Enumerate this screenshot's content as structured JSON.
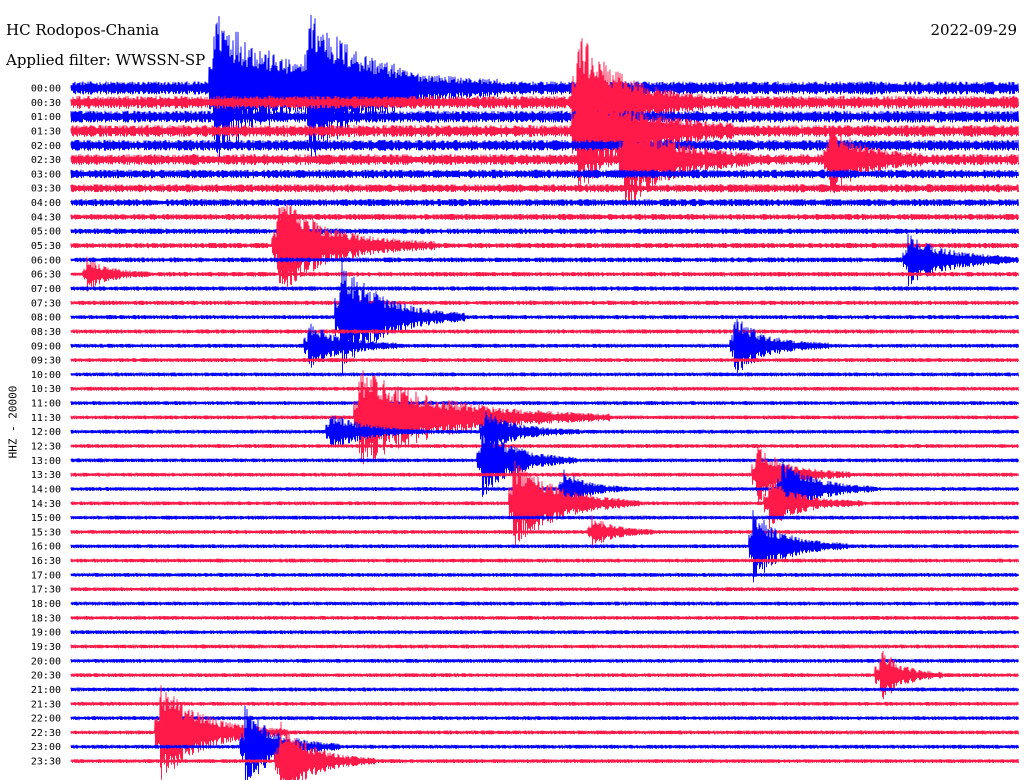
{
  "header": {
    "station": "HC Rodopos-Chania",
    "filter": "Applied filter: WWSSN-SP",
    "date": "2022-09-29"
  },
  "colors": {
    "trace_a": "#0000ff",
    "trace_b": "#ff1a4a",
    "background": "#ffffff"
  },
  "chart_data": {
    "type": "line",
    "ylabel": "HHZ - 20000",
    "row_labels": [
      "00:00",
      "00:30",
      "01:00",
      "01:30",
      "02:00",
      "02:30",
      "03:00",
      "03:30",
      "04:00",
      "04:30",
      "05:00",
      "05:30",
      "06:00",
      "06:30",
      "07:00",
      "07:30",
      "08:00",
      "08:30",
      "09:00",
      "09:30",
      "10:00",
      "10:30",
      "11:00",
      "11:30",
      "12:00",
      "12:30",
      "13:00",
      "13:30",
      "14:00",
      "14:30",
      "15:00",
      "15:30",
      "16:00",
      "16:30",
      "17:00",
      "17:30",
      "18:00",
      "18:30",
      "19:00",
      "19:30",
      "20:00",
      "20:30",
      "21:00",
      "21:30",
      "22:00",
      "22:30",
      "23:00",
      "23:30"
    ],
    "row_minutes": 30,
    "color_alternation": [
      "blue",
      "red"
    ],
    "noise_level_by_row": [
      1.0,
      1.0,
      0.9,
      0.9,
      0.8,
      0.8,
      0.6,
      0.55,
      0.45,
      0.35,
      0.3,
      0.28,
      0.25,
      0.22,
      0.2,
      0.2,
      0.18,
      0.18,
      0.16,
      0.16,
      0.15,
      0.15,
      0.15,
      0.15,
      0.15,
      0.15,
      0.15,
      0.15,
      0.15,
      0.15,
      0.15,
      0.15,
      0.15,
      0.15,
      0.15,
      0.15,
      0.15,
      0.15,
      0.15,
      0.15,
      0.15,
      0.15,
      0.15,
      0.15,
      0.15,
      0.15,
      0.15,
      0.15
    ],
    "events": [
      {
        "row": 0,
        "minute": 4.5,
        "amplitude": 4.0,
        "duration_min": 6
      },
      {
        "row": 0,
        "minute": 7.5,
        "amplitude": 3.0,
        "duration_min": 6
      },
      {
        "row": 1,
        "minute": 16,
        "amplitude": 3.5,
        "duration_min": 4
      },
      {
        "row": 3,
        "minute": 16,
        "amplitude": 3.0,
        "duration_min": 5
      },
      {
        "row": 5,
        "minute": 17.5,
        "amplitude": 2.5,
        "duration_min": 4
      },
      {
        "row": 5,
        "minute": 24,
        "amplitude": 1.8,
        "duration_min": 3
      },
      {
        "row": 11,
        "minute": 6.5,
        "amplitude": 2.5,
        "duration_min": 5
      },
      {
        "row": 12,
        "minute": 26.5,
        "amplitude": 1.2,
        "duration_min": 4
      },
      {
        "row": 13,
        "minute": 0.5,
        "amplitude": 0.8,
        "duration_min": 2
      },
      {
        "row": 16,
        "minute": 8.5,
        "amplitude": 3.0,
        "duration_min": 4
      },
      {
        "row": 18,
        "minute": 21,
        "amplitude": 1.5,
        "duration_min": 3
      },
      {
        "row": 18,
        "minute": 7.5,
        "amplitude": 1.2,
        "duration_min": 3
      },
      {
        "row": 23,
        "minute": 9.1,
        "amplitude": 2.5,
        "duration_min": 8
      },
      {
        "row": 24,
        "minute": 8.2,
        "amplitude": 1.0,
        "duration_min": 3
      },
      {
        "row": 24,
        "minute": 13.1,
        "amplitude": 1.0,
        "duration_min": 3
      },
      {
        "row": 26,
        "minute": 13,
        "amplitude": 2.0,
        "duration_min": 3
      },
      {
        "row": 27,
        "minute": 21.7,
        "amplitude": 1.5,
        "duration_min": 3
      },
      {
        "row": 28,
        "minute": 15.6,
        "amplitude": 1.0,
        "duration_min": 2
      },
      {
        "row": 28,
        "minute": 22.5,
        "amplitude": 1.5,
        "duration_min": 3
      },
      {
        "row": 29,
        "minute": 14,
        "amplitude": 2.5,
        "duration_min": 4
      },
      {
        "row": 29,
        "minute": 22.1,
        "amplitude": 1.2,
        "duration_min": 3
      },
      {
        "row": 31,
        "minute": 16.5,
        "amplitude": 0.8,
        "duration_min": 2
      },
      {
        "row": 32,
        "minute": 21.6,
        "amplitude": 1.8,
        "duration_min": 3
      },
      {
        "row": 41,
        "minute": 25.6,
        "amplitude": 1.5,
        "duration_min": 2
      },
      {
        "row": 45,
        "minute": 2.8,
        "amplitude": 2.5,
        "duration_min": 4
      },
      {
        "row": 46,
        "minute": 5.5,
        "amplitude": 2.0,
        "duration_min": 3
      },
      {
        "row": 47,
        "minute": 6.6,
        "amplitude": 2.0,
        "duration_min": 3
      }
    ]
  }
}
